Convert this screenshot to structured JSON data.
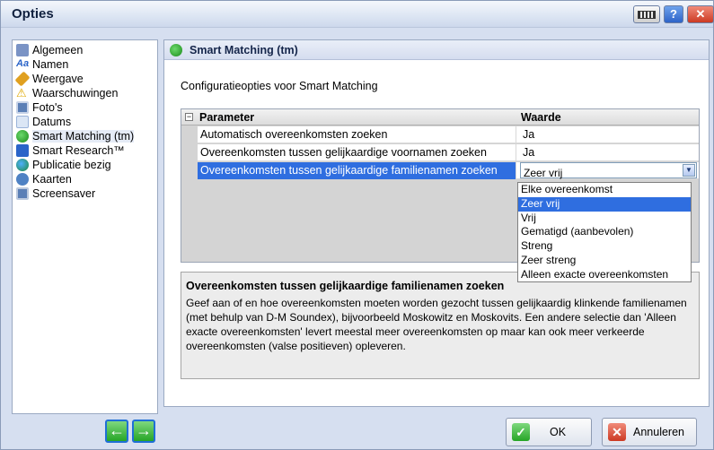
{
  "window": {
    "title": "Opties",
    "help_glyph": "?",
    "close_glyph": "✕"
  },
  "sidebar": {
    "items": [
      {
        "label": "Algemeen",
        "icon": "general-settings-icon",
        "color": "#7a93c5"
      },
      {
        "label": "Namen",
        "icon": "font-aa-icon",
        "color": "#2a64c9"
      },
      {
        "label": "Weergave",
        "icon": "paint-brush-icon",
        "color": "#e0a020"
      },
      {
        "label": "Waarschuwingen",
        "icon": "warning-triangle-icon",
        "color": "#f1c40f"
      },
      {
        "label": "Foto's",
        "icon": "photo-frame-icon",
        "color": "#5b7fb6"
      },
      {
        "label": "Datums",
        "icon": "calendar-icon",
        "color": "#9ab3d9"
      },
      {
        "label": "Smart Matching (tm)",
        "icon": "smart-matching-icon",
        "color": "#2ba02b",
        "selected": true
      },
      {
        "label": "Smart Research™",
        "icon": "smart-research-icon",
        "color": "#2a64c9"
      },
      {
        "label": "Publicatie bezig",
        "icon": "globe-icon",
        "color": "#1d8a3a"
      },
      {
        "label": "Kaarten",
        "icon": "map-icon",
        "color": "#4f82c4"
      },
      {
        "label": "Screensaver",
        "icon": "monitor-icon",
        "color": "#5b7fb6"
      }
    ]
  },
  "section": {
    "title": "Smart Matching (tm)",
    "description": "Configuratieopties voor Smart Matching"
  },
  "grid": {
    "col_param": "Parameter",
    "col_value": "Waarde",
    "collapse_glyph": "−",
    "rows": [
      {
        "param": "Automatisch overeenkomsten zoeken",
        "value": "Ja"
      },
      {
        "param": "Overeenkomsten tussen gelijkaardige voornamen zoeken",
        "value": "Ja"
      },
      {
        "param": "Overeenkomsten tussen gelijkaardige familienamen zoeken",
        "value": "Zeer vrij"
      }
    ]
  },
  "dropdown": {
    "options": [
      "Elke overeenkomst",
      "Zeer vrij",
      "Vrij",
      "Gematigd (aanbevolen)",
      "Streng",
      "Zeer streng",
      "Alleen exacte overeenkomsten"
    ],
    "selected": "Zeer vrij"
  },
  "help": {
    "title": "Overeenkomsten tussen gelijkaardige familienamen zoeken",
    "text": "Geef aan of en hoe overeenkomsten moeten worden gezocht tussen gelijkaardig klinkende familienamen (met behulp van D-M Soundex), bijvoorbeeld Moskowitz en Moskovits. Een andere selectie dan 'Alleen exacte overeenkomsten' levert meestal meer overeenkomsten op maar kan ook meer verkeerde overeenkomsten (valse positieven) opleveren."
  },
  "footer": {
    "back_glyph": "←",
    "forward_glyph": "→",
    "ok_label": "OK",
    "ok_glyph": "✓",
    "cancel_label": "Annuleren",
    "cancel_glyph": "✕"
  }
}
